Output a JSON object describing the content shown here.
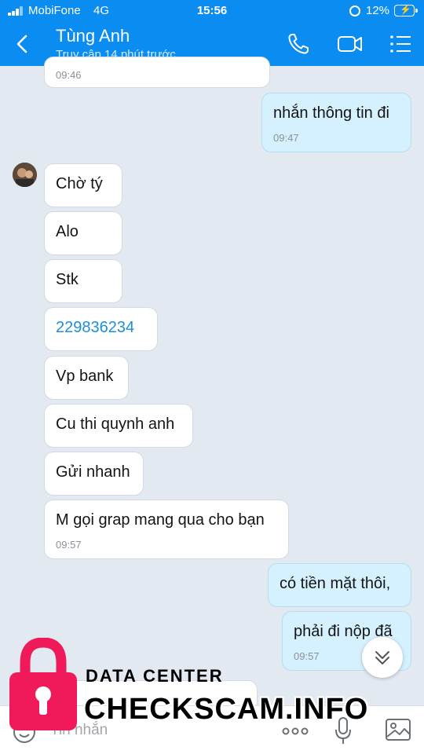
{
  "status_bar": {
    "carrier": "MobiFone",
    "network": "4G",
    "time": "15:56",
    "battery": "12%"
  },
  "header": {
    "title": "Tùng Anh",
    "subtitle": "Truy cập 14 phút trước",
    "back_icon": "chevron-left-icon",
    "call_icon": "phone-icon",
    "video_icon": "video-camera-icon",
    "menu_icon": "list-icon"
  },
  "messages": [
    {
      "from": "them",
      "text": "",
      "time": "09:46"
    },
    {
      "from": "me",
      "text": "nhắn thông tin đi",
      "time": "09:47"
    },
    {
      "from": "them",
      "text": "Chờ tý"
    },
    {
      "from": "them",
      "text": "Alo"
    },
    {
      "from": "them",
      "text": "Stk"
    },
    {
      "from": "them",
      "text": "229836234"
    },
    {
      "from": "them",
      "text": "Vp bank"
    },
    {
      "from": "them",
      "text": "Cu thi quynh anh"
    },
    {
      "from": "them",
      "text": "Gửi nhanh"
    },
    {
      "from": "them",
      "text": "M gọi grap mang qua cho bạn",
      "time": "09:57"
    },
    {
      "from": "me",
      "text": "có tiền mặt thôi,"
    },
    {
      "from": "me",
      "text": "phải đi nộp đã",
      "time": "09:57"
    }
  ],
  "input": {
    "placeholder": "Tin nhắn"
  },
  "watermark": {
    "line1": "DATA CENTER",
    "line2": "CHECKSCAM.INFO"
  },
  "colors": {
    "brand_blue": "#0a8cf0",
    "my_bubble": "#d5f1ff",
    "their_bubble": "#ffffff",
    "chat_background": "#e2e9f1",
    "link": "#1c8fd9",
    "watermark_lock": "#f0195a"
  }
}
